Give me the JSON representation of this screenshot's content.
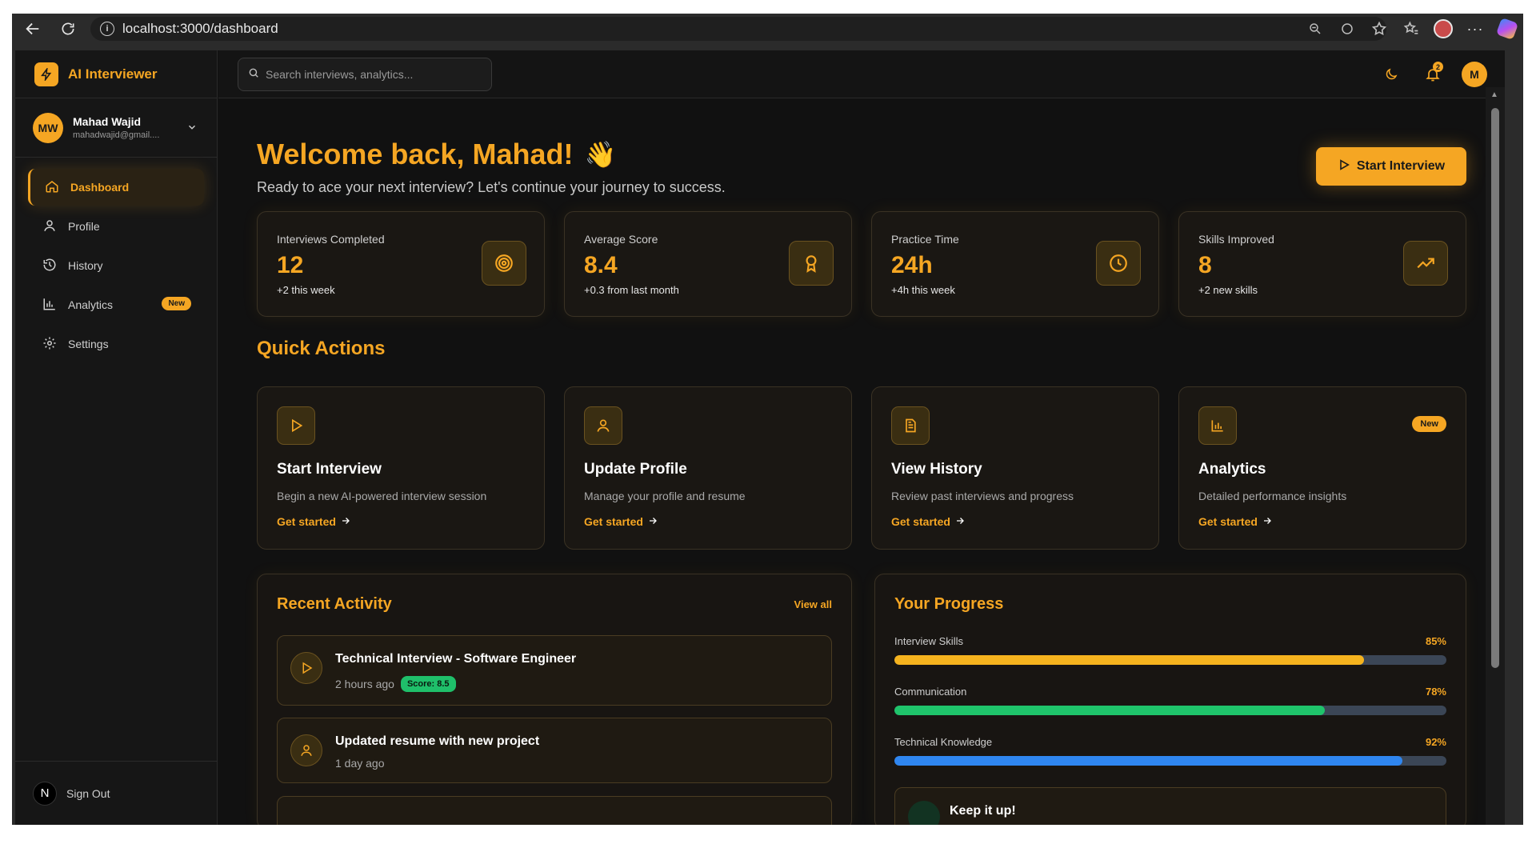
{
  "browser": {
    "url": "localhost:3000/dashboard"
  },
  "app": {
    "brand": "AI Interviewer",
    "accent": "#f5a623"
  },
  "user": {
    "initials": "MW",
    "name": "Mahad Wajid",
    "email": "mahadwajid@gmail....",
    "top_initial": "M"
  },
  "sidebar": {
    "items": [
      {
        "label": "Dashboard",
        "icon": "home-icon",
        "active": true
      },
      {
        "label": "Profile",
        "icon": "user-icon"
      },
      {
        "label": "History",
        "icon": "history-icon"
      },
      {
        "label": "Analytics",
        "icon": "bar-chart-icon",
        "badge": "New"
      },
      {
        "label": "Settings",
        "icon": "gear-icon"
      }
    ],
    "signout": "Sign Out",
    "signout_logo": "N"
  },
  "topbar": {
    "search_placeholder": "Search interviews, analytics...",
    "notifications_count": "2"
  },
  "main": {
    "welcome": "Welcome back, Mahad!",
    "welcome_emoji": "👋",
    "subtitle": "Ready to ace your next interview? Let's continue your journey to success.",
    "start_button": "Start Interview"
  },
  "stats": [
    {
      "label": "Interviews Completed",
      "value": "12",
      "sub": "+2 this week",
      "icon": "target-icon"
    },
    {
      "label": "Average Score",
      "value": "8.4",
      "sub": "+0.3 from last month",
      "icon": "award-icon"
    },
    {
      "label": "Practice Time",
      "value": "24h",
      "sub": "+4h this week",
      "icon": "clock-icon"
    },
    {
      "label": "Skills Improved",
      "value": "8",
      "sub": "+2 new skills",
      "icon": "trending-up-icon"
    }
  ],
  "quick_actions": {
    "title": "Quick Actions",
    "items": [
      {
        "title": "Start Interview",
        "desc": "Begin a new AI-powered interview session",
        "link": "Get started",
        "icon": "play-icon"
      },
      {
        "title": "Update Profile",
        "desc": "Manage your profile and resume",
        "link": "Get started",
        "icon": "user-icon"
      },
      {
        "title": "View History",
        "desc": "Review past interviews and progress",
        "link": "Get started",
        "icon": "document-icon"
      },
      {
        "title": "Analytics",
        "desc": "Detailed performance insights",
        "link": "Get started",
        "icon": "bar-chart-icon",
        "badge": "New"
      }
    ]
  },
  "recent_activity": {
    "title": "Recent Activity",
    "view_all": "View all",
    "items": [
      {
        "title": "Technical Interview - Software Engineer",
        "time": "2 hours ago",
        "score": "Score: 8.5",
        "icon": "play-icon"
      },
      {
        "title": "Updated resume with new project",
        "time": "1 day ago",
        "icon": "user-icon"
      }
    ]
  },
  "progress": {
    "title": "Your Progress",
    "items": [
      {
        "label": "Interview Skills",
        "pct_text": "85%",
        "value": 0.85,
        "color": "#f5b31e"
      },
      {
        "label": "Communication",
        "pct_text": "78%",
        "value": 0.78,
        "color": "#1fc46b"
      },
      {
        "label": "Technical Knowledge",
        "pct_text": "92%",
        "value": 0.92,
        "color": "#2f86f0"
      }
    ],
    "keep_it_up": "Keep it up!"
  }
}
